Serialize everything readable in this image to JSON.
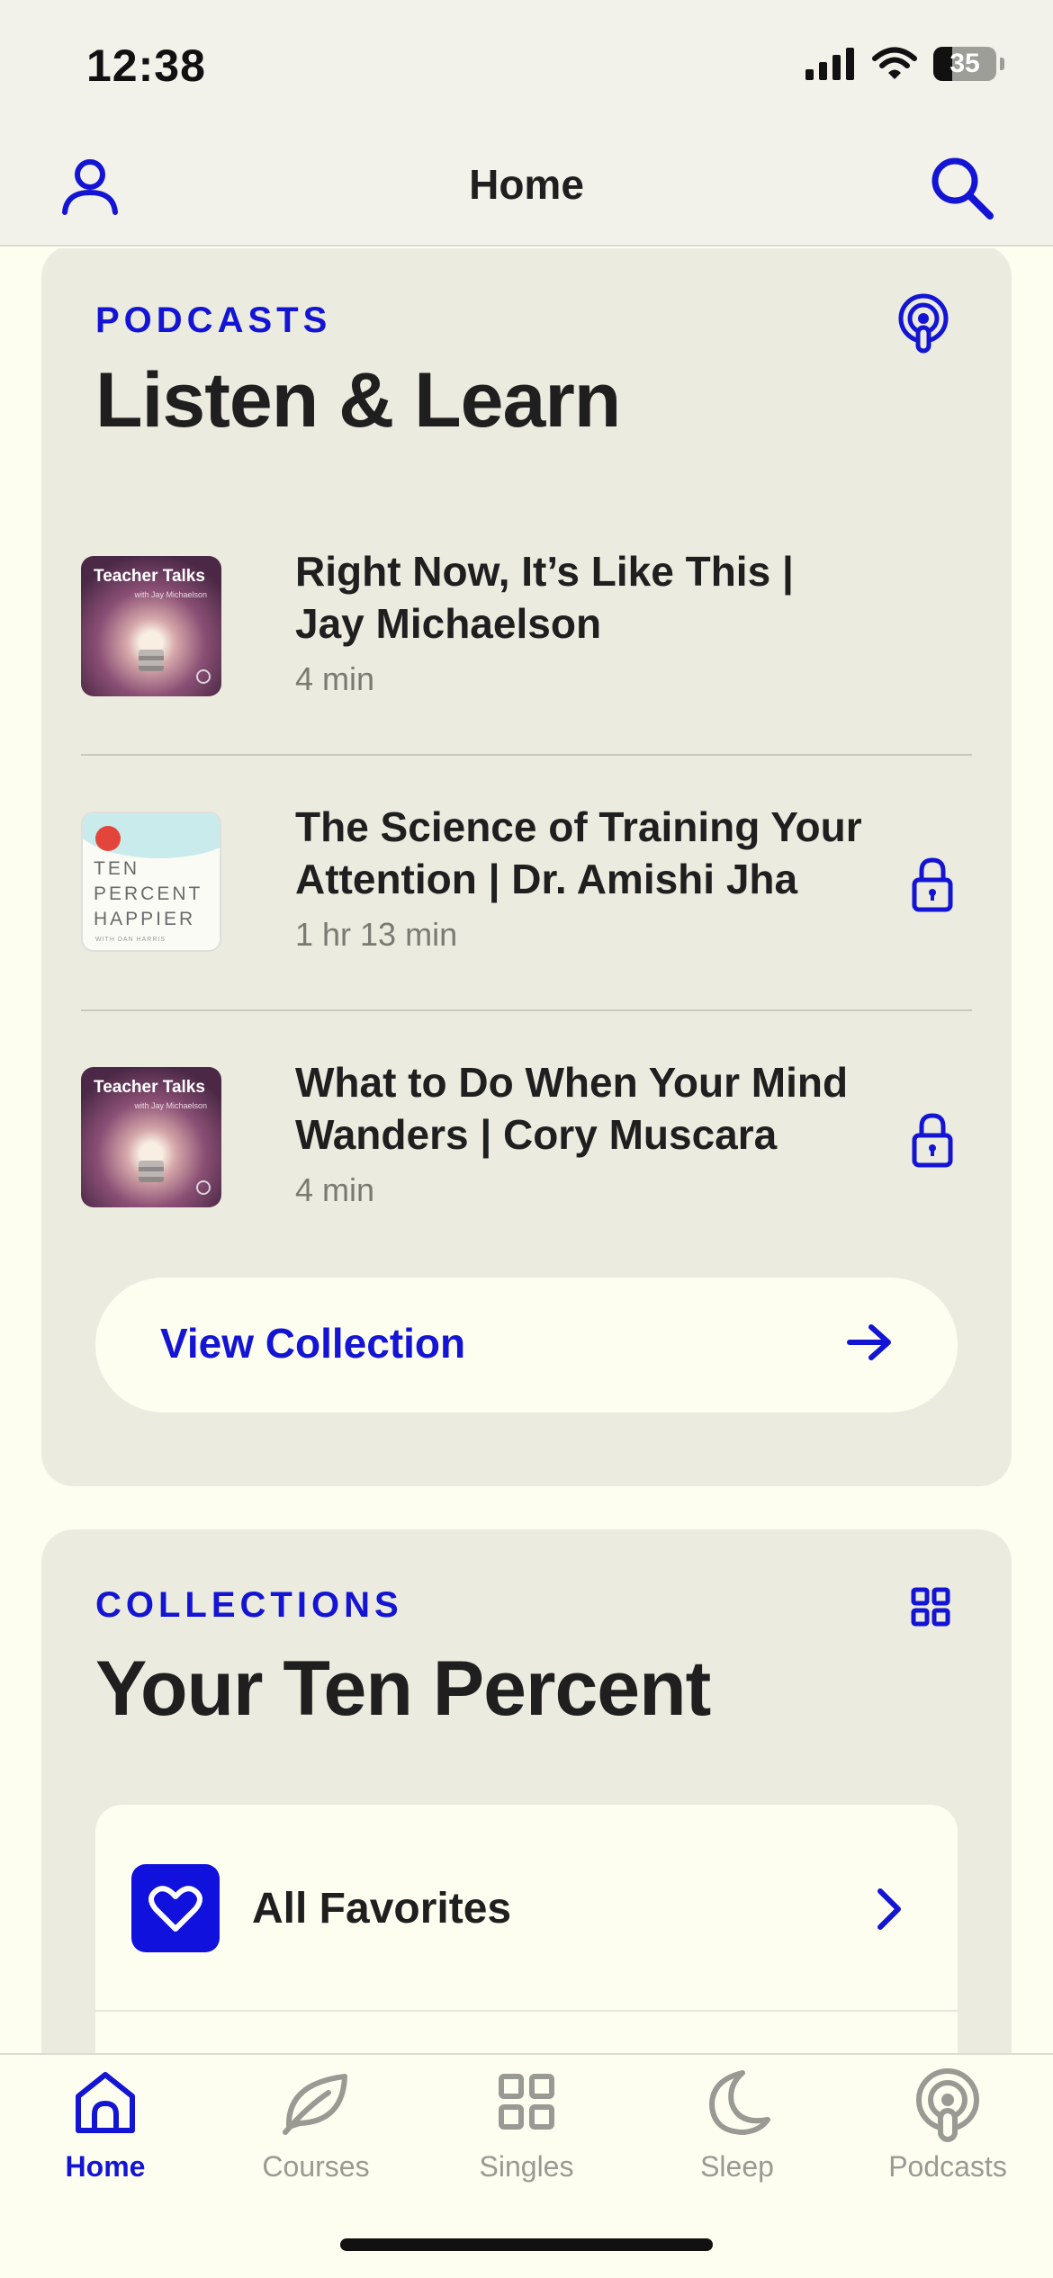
{
  "status_bar": {
    "time": "12:38",
    "battery": "35"
  },
  "nav": {
    "title": "Home",
    "left_icon": "profile-icon",
    "right_icon": "search-icon"
  },
  "podcasts": {
    "eyebrow": "PODCASTS",
    "title": "Listen & Learn",
    "icon": "podcast-icon",
    "episodes": [
      {
        "title": "Right Now, It’s Like This | Jay Michaelson",
        "duration": "4 min",
        "locked": false,
        "thumb": {
          "label": "Teacher Talks",
          "sub": "with Jay Michaelson"
        }
      },
      {
        "title": "The Science of Training Your Attention | Dr. Amishi Jha",
        "duration": "1 hr 13 min",
        "locked": true,
        "thumb": {
          "label": "TEN PERCENT HAPPIER",
          "sub": "WITH DAN HARRIS"
        }
      },
      {
        "title": "What to Do When Your Mind Wanders | Cory Muscara",
        "duration": "4 min",
        "locked": true,
        "thumb": {
          "label": "Teacher Talks",
          "sub": "with Jay Michaelson"
        }
      }
    ],
    "view_button": "View Collection"
  },
  "collections": {
    "eyebrow": "COLLECTIONS",
    "title": "Your Ten Percent",
    "icon": "grid-icon",
    "items": [
      {
        "label": "All Favorites",
        "icon": "heart-icon"
      }
    ]
  },
  "tabs": [
    {
      "label": "Home",
      "icon": "home-icon",
      "active": true
    },
    {
      "label": "Courses",
      "icon": "leaf-icon",
      "active": false
    },
    {
      "label": "Singles",
      "icon": "grid-icon",
      "active": false
    },
    {
      "label": "Sleep",
      "icon": "moon-icon",
      "active": false
    },
    {
      "label": "Podcasts",
      "icon": "podcast-icon",
      "active": false
    }
  ],
  "colors": {
    "accent": "#1414d4",
    "background": "#fdfdf0",
    "card": "#ebebdf",
    "inactive": "#9a9a94"
  }
}
